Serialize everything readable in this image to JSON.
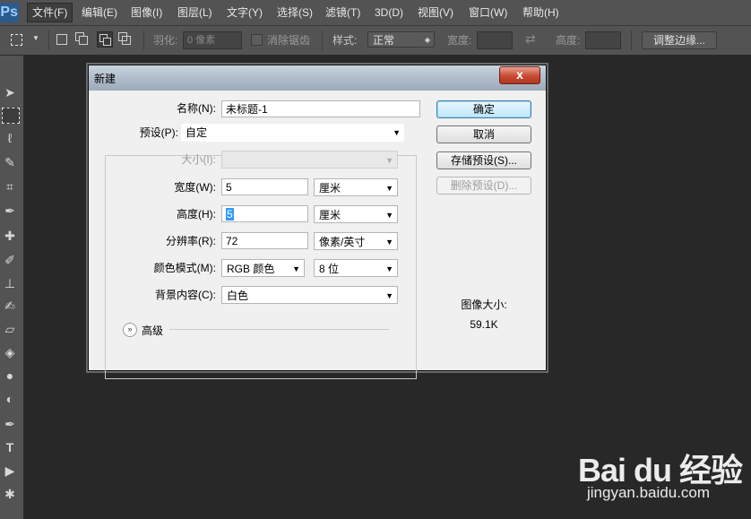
{
  "app": {
    "logo": "Ps"
  },
  "menu": [
    "文件(F)",
    "编辑(E)",
    "图像(I)",
    "图层(L)",
    "文字(Y)",
    "选择(S)",
    "滤镜(T)",
    "3D(D)",
    "视图(V)",
    "窗口(W)",
    "帮助(H)"
  ],
  "options": {
    "feather_label": "羽化:",
    "feather_value": "0 像素",
    "antialias_label": "消除锯齿",
    "style_label": "样式:",
    "style_value": "正常",
    "width_label": "宽度:",
    "height_label": "高度:",
    "refine_button": "调整边缘..."
  },
  "dialog": {
    "title": "新建",
    "close": "x",
    "name_label": "名称(N):",
    "name_value": "未标题-1",
    "preset_label": "预设(P):",
    "preset_value": "自定",
    "size_label": "大小(I):",
    "width_label": "宽度(W):",
    "width_value": "5",
    "width_unit": "厘米",
    "height_label": "高度(H):",
    "height_value": "5",
    "height_unit": "厘米",
    "resolution_label": "分辨率(R):",
    "resolution_value": "72",
    "resolution_unit": "像素/英寸",
    "color_mode_label": "颜色模式(M):",
    "color_mode_value": "RGB 颜色",
    "bit_depth_value": "8 位",
    "background_label": "背景内容(C):",
    "background_value": "白色",
    "advanced_label": "高级",
    "buttons": {
      "ok": "确定",
      "cancel": "取消",
      "save_preset": "存储预设(S)...",
      "delete_preset": "删除预设(D)..."
    },
    "image_size_label": "图像大小:",
    "image_size_value": "59.1K"
  },
  "watermark": {
    "brand": "Bai du 经验",
    "url": "jingyan.baidu.com"
  }
}
